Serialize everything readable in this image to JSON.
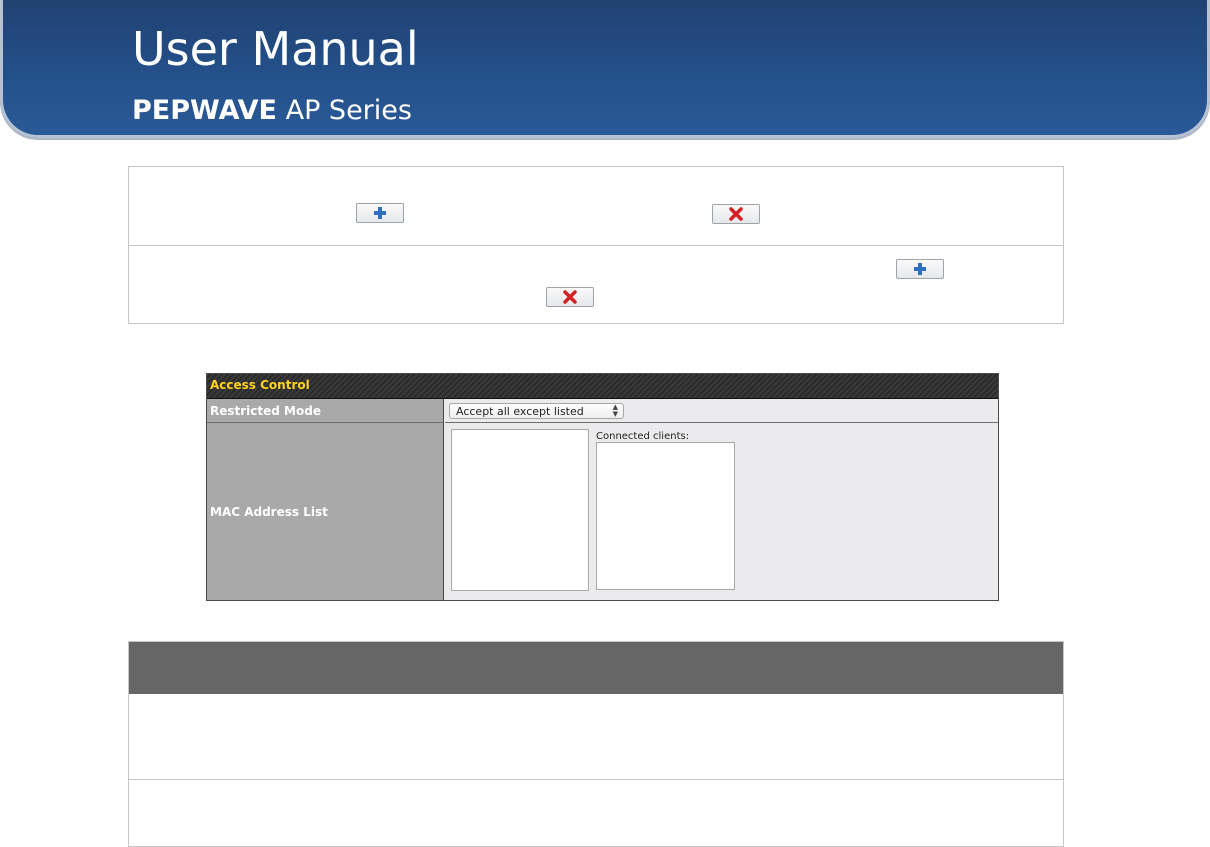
{
  "banner": {
    "title": "User Manual",
    "brand": "PEPWAVE",
    "series": "AP Series"
  },
  "icons": {
    "add": "plus-icon",
    "remove": "x-icon"
  },
  "access_control": {
    "header": "Access Control",
    "restricted_mode_label": "Restricted Mode",
    "restricted_mode_value": "Accept all except listed",
    "mac_list_label": "MAC Address List",
    "connected_clients_label": "Connected clients:"
  },
  "colors": {
    "banner": "#24508a",
    "header_text": "#ffd21a",
    "add_icon": "#2f6fbf",
    "remove_icon": "#d42020"
  }
}
